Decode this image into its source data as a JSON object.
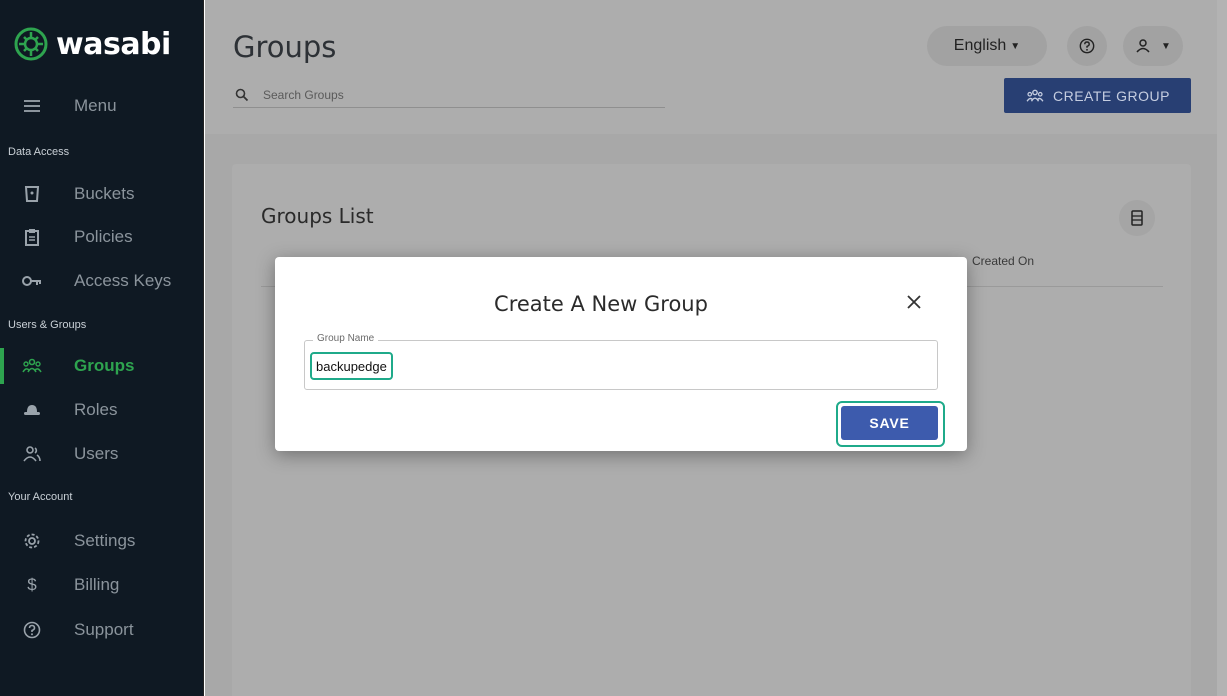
{
  "brand": {
    "name": "wasabi"
  },
  "sidebar": {
    "menu_label": "Menu",
    "sections": [
      "Data Access",
      "Users & Groups",
      "Your Account"
    ],
    "items": [
      {
        "label": "Buckets",
        "icon": "bucket-icon"
      },
      {
        "label": "Policies",
        "icon": "clipboard-icon"
      },
      {
        "label": "Access Keys",
        "icon": "key-icon"
      },
      {
        "label": "Groups",
        "icon": "group-icon",
        "active": true
      },
      {
        "label": "Roles",
        "icon": "hat-icon"
      },
      {
        "label": "Users",
        "icon": "users-icon"
      },
      {
        "label": "Settings",
        "icon": "gear-icon"
      },
      {
        "label": "Billing",
        "icon": "dollar-icon"
      },
      {
        "label": "Support",
        "icon": "help-icon"
      }
    ]
  },
  "header": {
    "title": "Groups",
    "search_placeholder": "Search Groups",
    "language": "English",
    "create_button": "CREATE GROUP"
  },
  "card": {
    "title": "Groups List",
    "columns": [
      "Created On"
    ]
  },
  "modal": {
    "title": "Create A New Group",
    "field_label": "Group Name",
    "field_value": "backupedge",
    "save_label": "SAVE"
  },
  "colors": {
    "sidebar_bg": "#0f1923",
    "active_green": "#2ea44f",
    "primary_blue": "#3d5bad",
    "highlight_teal": "#1faa8a"
  }
}
